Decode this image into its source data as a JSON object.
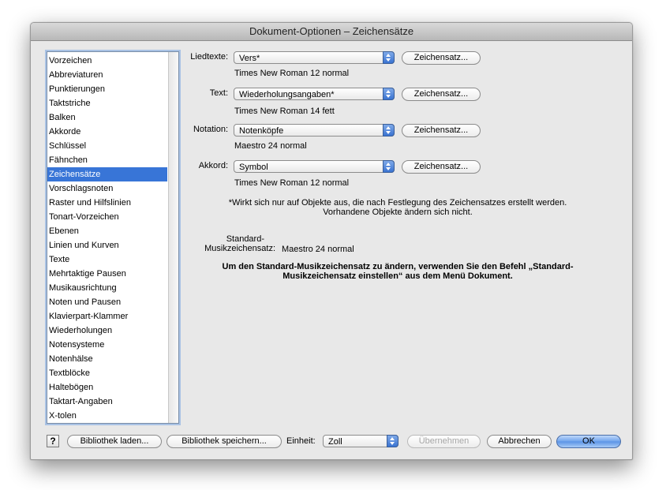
{
  "window": {
    "title": "Dokument-Optionen – Zeichensätze"
  },
  "sidebar": {
    "selected_index": 8,
    "items": [
      "Vorzeichen",
      "Abbreviaturen",
      "Punktierungen",
      "Taktstriche",
      "Balken",
      "Akkorde",
      "Schlüssel",
      "Fähnchen",
      "Zeichensätze",
      "Vorschlagsnoten",
      "Raster und Hilfslinien",
      "Tonart-Vorzeichen",
      "Ebenen",
      "Linien und Kurven",
      "Texte",
      "Mehrtaktige Pausen",
      "Musikausrichtung",
      "Noten und Pausen",
      "Klavierpart-Klammer",
      "Wiederholungen",
      "Notensysteme",
      "Notenhälse",
      "Textblöcke",
      "Haltebögen",
      "Taktart-Angaben",
      "X-tolen"
    ]
  },
  "fonts": [
    {
      "label": "Liedtexte:",
      "value": "Vers*",
      "button": "Zeichensatz...",
      "info": "Times New Roman 12 normal"
    },
    {
      "label": "Text:",
      "value": "Wiederholungsangaben*",
      "button": "Zeichensatz...",
      "info": "Times New Roman 14 fett"
    },
    {
      "label": "Notation:",
      "value": "Notenköpfe",
      "button": "Zeichensatz...",
      "info": "Maestro 24 normal"
    },
    {
      "label": "Akkord:",
      "value": "Symbol",
      "button": "Zeichensatz...",
      "info": "Times New Roman 12 normal"
    }
  ],
  "note": {
    "line1": "*Wirkt sich nur auf Objekte aus, die nach Festlegung des Zeichensatzes erstellt werden.",
    "line2": "Vorhandene Objekte ändern sich nicht."
  },
  "standard": {
    "label_line1": "Standard-",
    "label_line2": "Musikzeichensatz:",
    "value": "Maestro 24 normal"
  },
  "instruction": {
    "line1": "Um den Standard-Musikzeichensatz zu ändern, verwenden Sie den Befehl „Standard-",
    "line2": "Musikzeichensatz einstellen“ aus dem Menü Dokument."
  },
  "footer": {
    "help_label": "?",
    "load_label": "Bibliothek laden...",
    "save_label": "Bibliothek speichern...",
    "unit_label": "Einheit:",
    "unit_value": "Zoll",
    "apply_label": "Übernehmen",
    "cancel_label": "Abbrechen",
    "ok_label": "OK"
  },
  "colors": {
    "selection": "#3875d7",
    "accent": "#5a93e6"
  }
}
